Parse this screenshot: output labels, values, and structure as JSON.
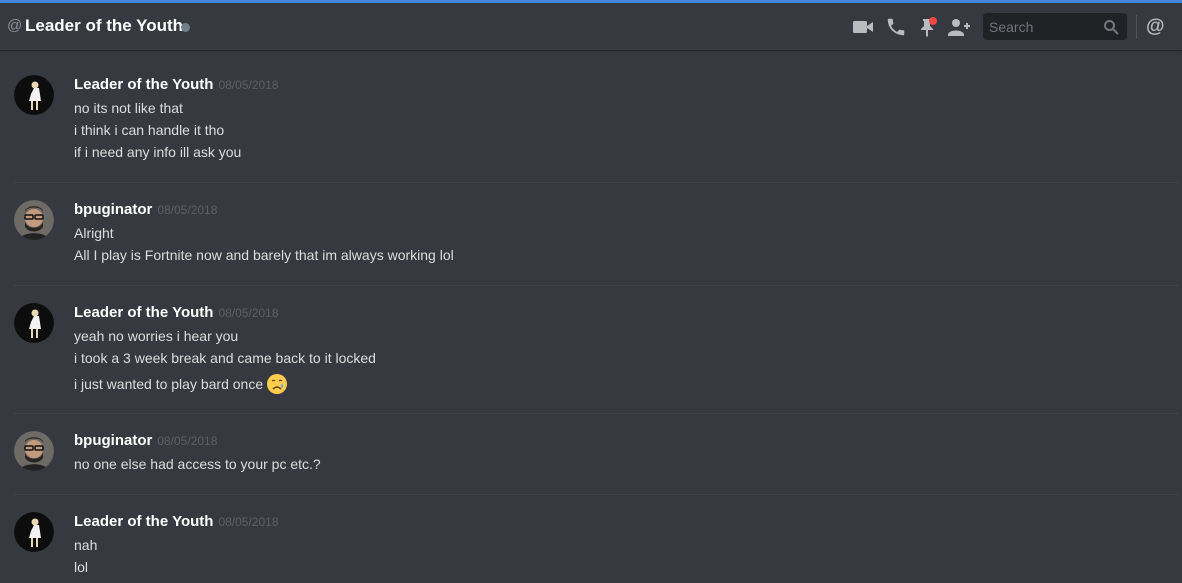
{
  "header": {
    "at_symbol": "@",
    "channel_name": "Leader of the Youth",
    "search_placeholder": "Search",
    "mention_symbol": "@"
  },
  "icons": {
    "video": "video-call-icon",
    "call": "phone-call-icon",
    "pins": "pinned-messages-icon",
    "add_friend": "add-friend-icon",
    "search": "search-icon",
    "mentions": "mentions-icon"
  },
  "colors": {
    "accent_top": "#3f86d8",
    "background": "#36393f",
    "pin_badge": "#f04747",
    "status_offline": "#747f8d",
    "timestamp": "#5d6167"
  },
  "messages": [
    {
      "author": "Leader of the Youth",
      "timestamp": "08/05/2018",
      "lines": [
        "no its not like that",
        "i think i can handle it tho",
        "if i need any info ill ask you"
      ]
    },
    {
      "author": "bpuginator",
      "timestamp": "08/05/2018",
      "lines": [
        "Alright",
        "All I play is Fortnite now and barely that im always working lol"
      ]
    },
    {
      "author": "Leader of the Youth",
      "timestamp": "08/05/2018",
      "lines": [
        "yeah no worries i hear you",
        "i took a 3 week break and came back to it locked",
        "i just wanted to play bard once"
      ],
      "emoji": "crying-face-emoji"
    },
    {
      "author": "bpuginator",
      "timestamp": "08/05/2018",
      "lines": [
        "no one else had access to your pc etc.?"
      ]
    },
    {
      "author": "Leader of the Youth",
      "timestamp": "08/05/2018",
      "lines": [
        "nah",
        "lol"
      ]
    }
  ]
}
